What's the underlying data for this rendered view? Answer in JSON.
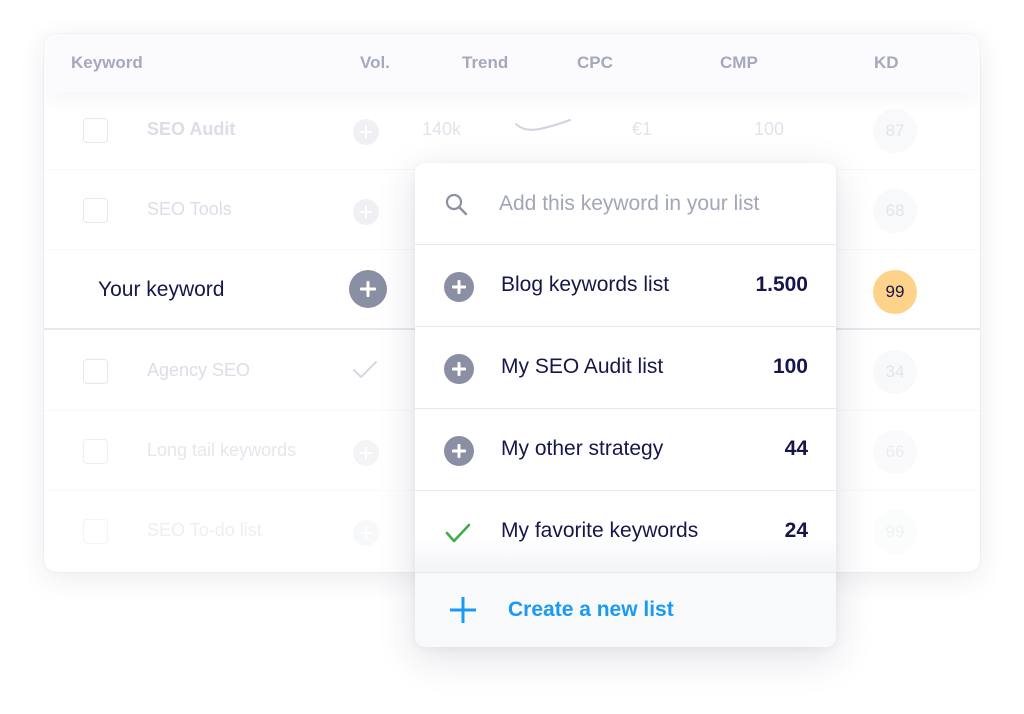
{
  "table": {
    "columns": [
      "Keyword",
      "Vol.",
      "Trend",
      "CPC",
      "CMP",
      "KD"
    ],
    "rows": [
      {
        "keyword": "SEO Audit",
        "volume": "140k",
        "cpc": "€1",
        "cmp": "100",
        "kd": "87",
        "action": "add",
        "bold": true
      },
      {
        "keyword": "SEO Tools",
        "volume": "",
        "cpc": "",
        "cmp": "",
        "kd": "68",
        "action": "add",
        "bold": false
      },
      {
        "keyword": "Your keyword",
        "volume": "",
        "cpc": "",
        "cmp": "",
        "kd": "99",
        "action": "add",
        "active": true
      },
      {
        "keyword": "Agency SEO",
        "volume": "",
        "cpc": "",
        "cmp": "",
        "kd": "34",
        "action": "added"
      },
      {
        "keyword": "Long tail keywords",
        "volume": "",
        "cpc": "",
        "cmp": "",
        "kd": "66",
        "action": "add"
      },
      {
        "keyword": "SEO To-do list",
        "volume": "",
        "cpc": "",
        "cmp": "",
        "kd": "99",
        "action": "add"
      }
    ]
  },
  "dropdown": {
    "search": {
      "placeholder": "Add this keyword in your list",
      "value": ""
    },
    "lists": [
      {
        "label": "Blog keywords list",
        "count": "1.500",
        "state": "add"
      },
      {
        "label": "My SEO Audit list",
        "count": "100",
        "state": "add"
      },
      {
        "label": "My other strategy",
        "count": "44",
        "state": "add"
      },
      {
        "label": "My favorite keywords",
        "count": "24",
        "state": "added"
      }
    ],
    "create_label": "Create a new list"
  },
  "icons": {
    "add": "plus-circle-icon",
    "added": "check-icon",
    "search": "search-icon",
    "create": "plus-icon"
  },
  "colors": {
    "accent": "#1a9af5",
    "text_dark": "#17164a",
    "kd_high": "#fdd38c",
    "check_green": "#3fae49",
    "icon_gray": "#8b8fa3"
  }
}
